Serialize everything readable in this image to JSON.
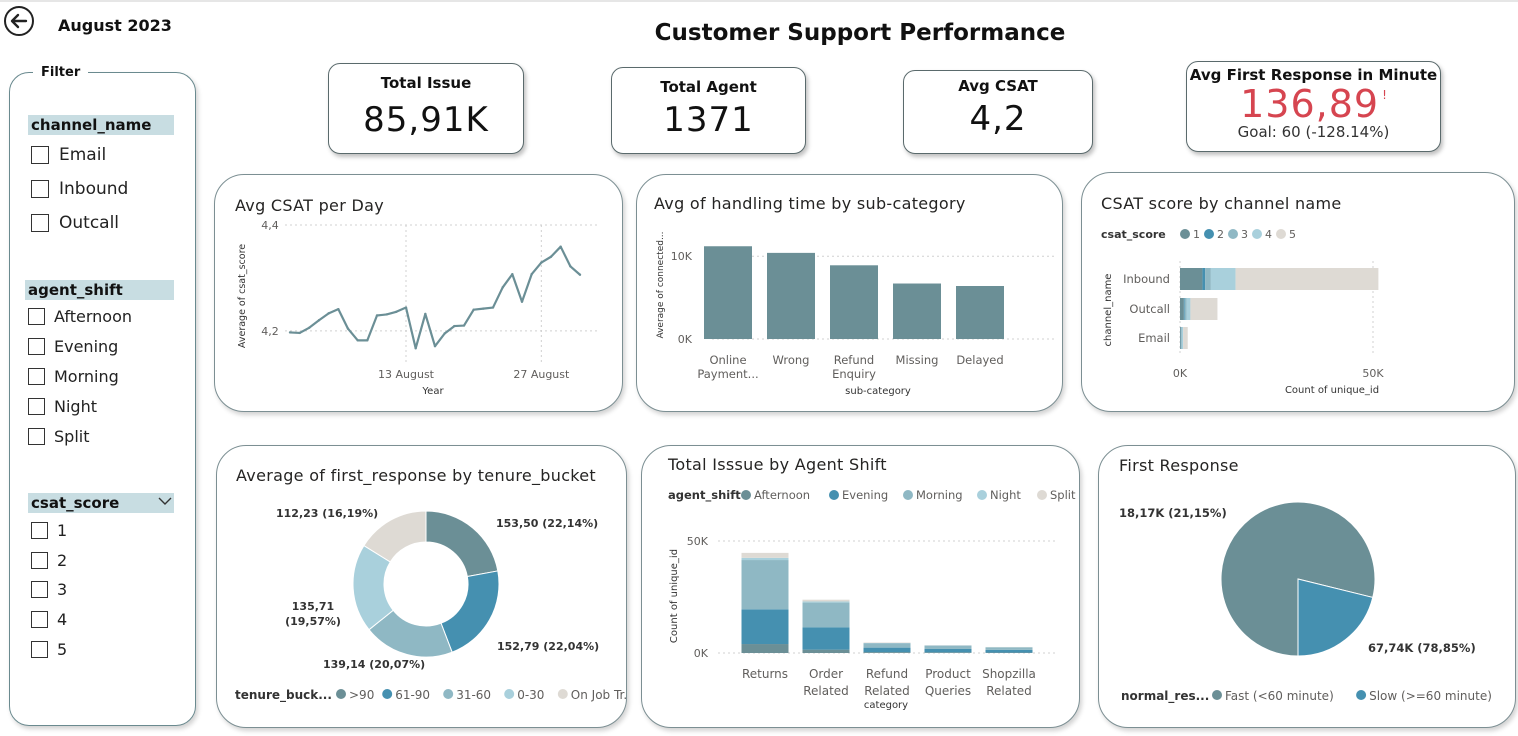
{
  "header": {
    "month": "August 2023",
    "title": "Customer Support Performance"
  },
  "filter": {
    "title": "Filter",
    "channel": {
      "label": "channel_name",
      "options": [
        "Email",
        "Inbound",
        "Outcall"
      ]
    },
    "shift": {
      "label": "agent_shift",
      "options": [
        "Afternoon",
        "Evening",
        "Morning",
        "Night",
        "Split"
      ]
    },
    "csat": {
      "label": "csat_score",
      "options": [
        "1",
        "2",
        "3",
        "4",
        "5"
      ]
    }
  },
  "kpis": {
    "total_issue": {
      "label": "Total Issue",
      "value": "85,91K"
    },
    "total_agent": {
      "label": "Total Agent",
      "value": "1371"
    },
    "avg_csat": {
      "label": "Avg CSAT",
      "value": "4,2"
    },
    "first_response": {
      "label": "Avg First Response in Minute",
      "value": "136,89",
      "alert": "!",
      "goal": "Goal: 60 (-128.14%)"
    }
  },
  "colors": {
    "teal_grey": "#6b8f96",
    "blue": "#4590b0",
    "mid_teal": "#8fb8c4",
    "light_blue": "#a9d0dc",
    "beige": "#dedad4",
    "alert_red": "#d64550"
  },
  "chart_data": [
    {
      "id": "avg_csat_per_day",
      "type": "line",
      "title": "Avg CSAT per Day",
      "xlabel": "Year",
      "ylabel": "Average of csat_score",
      "ylim": [
        4.16,
        4.4
      ],
      "yticks": [
        "4,2",
        "4,4"
      ],
      "xticks": [
        "13 August",
        "27 August"
      ],
      "x": [
        1,
        2,
        3,
        4,
        5,
        6,
        7,
        8,
        9,
        10,
        11,
        12,
        13,
        14,
        15,
        16,
        17,
        18,
        19,
        20,
        21,
        22,
        23,
        24,
        25,
        26,
        27,
        28,
        29,
        30,
        31
      ],
      "values": [
        4.197,
        4.196,
        4.206,
        4.22,
        4.233,
        4.241,
        4.204,
        4.182,
        4.182,
        4.229,
        4.231,
        4.236,
        4.244,
        4.167,
        4.232,
        4.171,
        4.195,
        4.209,
        4.21,
        4.24,
        4.242,
        4.244,
        4.282,
        4.307,
        4.255,
        4.307,
        4.329,
        4.34,
        4.359,
        4.322,
        4.306
      ],
      "grid": true
    },
    {
      "id": "handling_time_by_subcategory",
      "type": "bar",
      "title": "Avg of handling time by sub-category",
      "xlabel": "sub-category",
      "ylabel": "Average of connected...",
      "categories": [
        "Online Payment...",
        "Wrong",
        "Refund Enquiry",
        "Missing",
        "Delayed"
      ],
      "category_lines": [
        [
          "Online",
          "Payment..."
        ],
        [
          "Wrong"
        ],
        [
          "Refund",
          "Enquiry"
        ],
        [
          "Missing"
        ],
        [
          "Delayed"
        ]
      ],
      "values": [
        11200,
        10400,
        8900,
        6700,
        6400
      ],
      "ylim": [
        0,
        12800
      ],
      "yticks": [
        "0K",
        "10K"
      ]
    },
    {
      "id": "csat_by_channel",
      "type": "bar",
      "orientation": "horizontal",
      "stacked": true,
      "title": "CSAT score by channel name",
      "legend_title": "csat_score",
      "xlabel": "Count of unique_id",
      "ylabel": "channel_name",
      "categories": [
        "Inbound",
        "Outcall",
        "Email"
      ],
      "series": [
        {
          "name": "1",
          "values": [
            5800,
            1000,
            200
          ]
        },
        {
          "name": "2",
          "values": [
            700,
            200,
            100
          ]
        },
        {
          "name": "3",
          "values": [
            1500,
            500,
            200
          ]
        },
        {
          "name": "4",
          "values": [
            6400,
            1000,
            300
          ]
        },
        {
          "name": "5",
          "values": [
            37000,
            7000,
            1200
          ]
        }
      ],
      "xlim": [
        0,
        70000
      ],
      "xticks": [
        "0K",
        "50K"
      ]
    },
    {
      "id": "first_response_by_tenure",
      "type": "pie",
      "donut": true,
      "title": "Average of first_response by tenure_bucket",
      "legend_title": "tenure_buck...",
      "labels": [
        ">90",
        "61-90",
        "31-60",
        "0-30",
        "On Job Tr..."
      ],
      "values": [
        153.5,
        152.79,
        139.14,
        135.71,
        112.23
      ],
      "data_labels": [
        "153,50 (22,14%)",
        "152,79 (22,04%)",
        "139,14 (20,07%)",
        "135,71 (19,57%)",
        "112,23 (16,19%)"
      ]
    },
    {
      "id": "issue_by_shift",
      "type": "bar",
      "stacked": true,
      "title": "Total Isssue by Agent Shift",
      "legend_title": "agent_shift",
      "xlabel": "category",
      "ylabel": "Count of unique_id",
      "categories": [
        "Returns",
        "Order Related",
        "Refund Related",
        "Product Queries",
        "Shopzilla Related"
      ],
      "category_lines": [
        [
          "Returns"
        ],
        [
          "Order",
          "Related"
        ],
        [
          "Refund",
          "Related"
        ],
        [
          "Product",
          "Queries"
        ],
        [
          "Shopzilla",
          "Related"
        ]
      ],
      "series": [
        {
          "name": "Afternoon",
          "values": [
            4000,
            1500,
            400,
            300,
            200
          ]
        },
        {
          "name": "Evening",
          "values": [
            15500,
            10000,
            2000,
            1500,
            1200
          ]
        },
        {
          "name": "Morning",
          "values": [
            22000,
            11000,
            2000,
            1500,
            1100
          ]
        },
        {
          "name": "Night",
          "values": [
            1000,
            500,
            100,
            100,
            100
          ]
        },
        {
          "name": "Split",
          "values": [
            2200,
            800,
            200,
            100,
            100
          ]
        }
      ],
      "ylim": [
        0,
        50000
      ],
      "yticks": [
        "0K",
        "50K"
      ]
    },
    {
      "id": "first_response_split",
      "type": "pie",
      "title": "First Response",
      "legend_title": "normal_res...",
      "labels": [
        "Fast (<60 minute)",
        "Slow (>=60 minute)"
      ],
      "values": [
        67740,
        18170
      ],
      "data_labels": [
        "67,74K (78,85%)",
        "18,17K (21,15%)"
      ]
    }
  ]
}
